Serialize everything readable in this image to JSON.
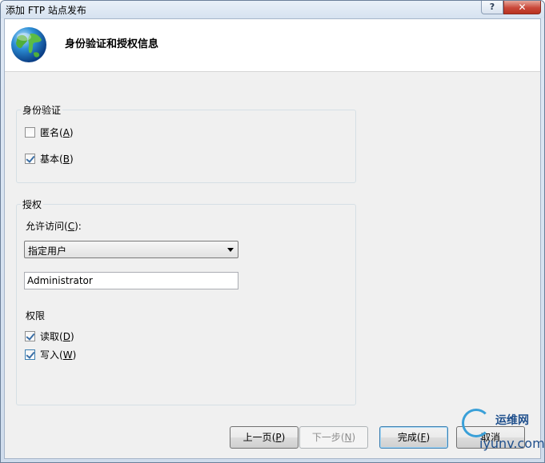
{
  "window": {
    "title": "添加 FTP 站点发布",
    "help_glyph": "?",
    "close_glyph": "✕"
  },
  "header": {
    "title": "身份验证和授权信息",
    "icon": "globe-icon"
  },
  "authentication": {
    "legend": "身份验证",
    "anonymous": {
      "label": "匿名",
      "accel": "A",
      "checked": false
    },
    "basic": {
      "label": "基本",
      "accel": "B",
      "checked": true
    }
  },
  "authorization": {
    "legend": "授权",
    "allow_access_label": "允许访问",
    "allow_access_accel": "C",
    "allow_access_suffix": "):",
    "select_value": "指定用户",
    "user_value": "Administrator",
    "permissions_label": "权限",
    "read": {
      "label": "读取",
      "accel": "D",
      "checked": true
    },
    "write": {
      "label": "写入",
      "accel": "W",
      "checked": true
    }
  },
  "buttons": {
    "previous": {
      "label": "上一页",
      "accel": "P"
    },
    "next": {
      "label": "下一步",
      "accel": "N"
    },
    "finish": {
      "label": "完成",
      "accel": "F"
    },
    "cancel": {
      "label": "取消"
    }
  },
  "watermark": {
    "line1": "运维网",
    "line2": "iyunv.com"
  },
  "colors": {
    "checkmark": "#3a6ea5",
    "default_button_border": "#3c7fb1",
    "close_button": "#c9483a"
  }
}
